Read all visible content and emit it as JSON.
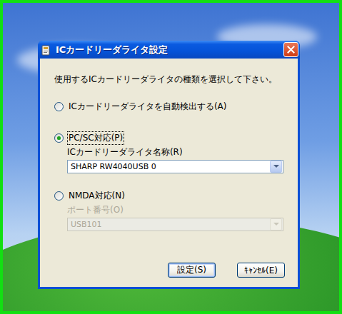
{
  "window": {
    "title": "ICカードリーダライタ設定"
  },
  "instruction": "使用するICカードリーダライタの種類を選択して下さい。",
  "options": [
    {
      "label": "ICカードリーダライタを自動検出する(A)",
      "selected": false
    },
    {
      "label": "PC/SC対応(P)",
      "selected": true,
      "field": {
        "label": "ICカードリーダライタ名称(R)",
        "value": "SHARP RW4040USB 0",
        "disabled": false
      }
    },
    {
      "label": "NMDA対応(N)",
      "selected": false,
      "field": {
        "label": "ポート番号(O)",
        "value": "USB101",
        "disabled": true
      }
    }
  ],
  "buttons": [
    {
      "label": "設定(S)",
      "default": true
    },
    {
      "label": "ｷｬﾝｾﾙ(E)",
      "default": false
    }
  ]
}
